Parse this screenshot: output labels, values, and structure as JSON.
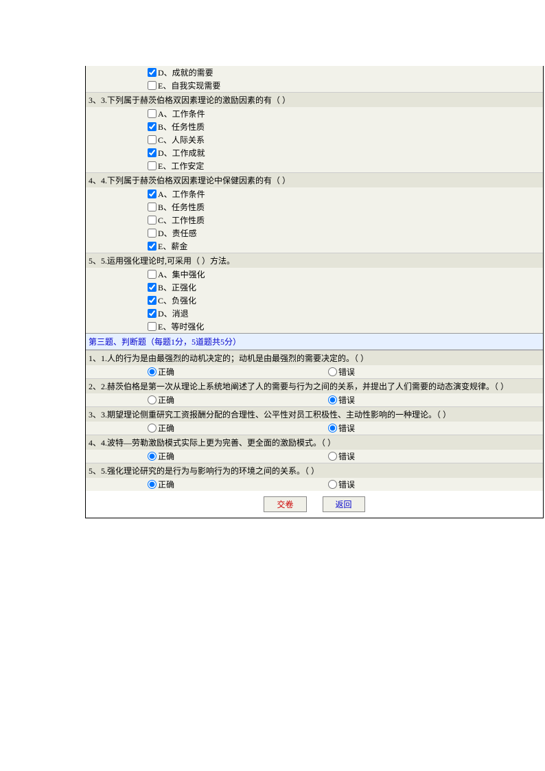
{
  "q2_remaining": [
    {
      "letter": "D",
      "text": "成就的需要",
      "checked": true
    },
    {
      "letter": "E",
      "text": "自我实现需要",
      "checked": false
    }
  ],
  "multi_questions": [
    {
      "num": "3、3.",
      "text": "下列属于赫茨伯格双因素理论的激励因素的有（  ）",
      "options": [
        {
          "letter": "A",
          "text": "工作条件",
          "checked": false
        },
        {
          "letter": "B",
          "text": "任务性质",
          "checked": true
        },
        {
          "letter": "C",
          "text": "人际关系",
          "checked": false
        },
        {
          "letter": "D",
          "text": "工作成就",
          "checked": true
        },
        {
          "letter": "E",
          "text": "工作安定",
          "checked": false
        }
      ]
    },
    {
      "num": "4、4.",
      "text": "下列属于赫茨伯格双因素理论中保健因素的有（  ）",
      "options": [
        {
          "letter": "A",
          "text": "工作条件",
          "checked": true
        },
        {
          "letter": "B",
          "text": "任务性质",
          "checked": false
        },
        {
          "letter": "C",
          "text": "工作性质",
          "checked": false
        },
        {
          "letter": "D",
          "text": "责任感",
          "checked": false
        },
        {
          "letter": "E",
          "text": "薪金",
          "checked": true
        }
      ]
    },
    {
      "num": "5、5.",
      "text": "运用强化理论时,可采用（  ）方法。",
      "options": [
        {
          "letter": "A",
          "text": "集中强化",
          "checked": false
        },
        {
          "letter": "B",
          "text": "正强化",
          "checked": true
        },
        {
          "letter": "C",
          "text": "负强化",
          "checked": true
        },
        {
          "letter": "D",
          "text": "消退",
          "checked": true
        },
        {
          "letter": "E",
          "text": "等时强化",
          "checked": false
        }
      ]
    }
  ],
  "section3_title": "第三题、判断题（每题1分，5道题共5分）",
  "tf_questions": [
    {
      "num": "1、1.",
      "text": "人的行为是由最强烈的动机决定的；动机是由最强烈的需要决定的。（  ）",
      "answer": "correct"
    },
    {
      "num": "2、2.",
      "text": "赫茨伯格是第一次从理论上系统地阐述了人的需要与行为之间的关系，并提出了人们需要的动态演变规律。（  ）",
      "answer": "wrong"
    },
    {
      "num": "3、3.",
      "text": "期望理论侧重研究工资报酬分配的合理性、公平性对员工积极性、主动性影响的一种理论。（  ）",
      "answer": "wrong"
    },
    {
      "num": "4、4.",
      "text": "波特—劳勒激励模式实际上更为完善、更全面的激励模式。（  ）",
      "answer": "correct"
    },
    {
      "num": "5、5.",
      "text": "强化理论研究的是行为与影响行为的环境之间的关系。（  ）",
      "answer": "correct"
    }
  ],
  "labels": {
    "correct": "正确",
    "wrong": "错误",
    "submit": "交卷",
    "back": "返回"
  }
}
